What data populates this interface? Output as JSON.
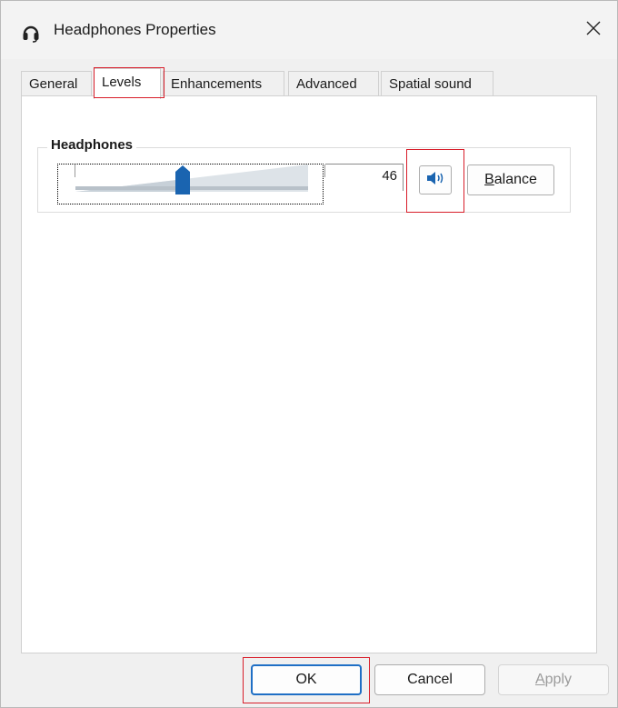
{
  "window": {
    "title": "Headphones Properties",
    "title_icon": "headphones-icon",
    "close_icon": "close-icon"
  },
  "tabs": [
    {
      "label": "General"
    },
    {
      "label": "Levels",
      "active": true
    },
    {
      "label": "Enhancements"
    },
    {
      "label": "Advanced"
    },
    {
      "label": "Spatial sound"
    }
  ],
  "levels": {
    "group_label": "Headphones",
    "volume_value": "46",
    "volume_level": 46,
    "mute_icon": "speaker-icon",
    "balance_prefix": "B",
    "balance_rest": "alance"
  },
  "footer": {
    "ok_label": "OK",
    "cancel_label": "Cancel",
    "apply_prefix": "A",
    "apply_rest": "pply"
  },
  "colors": {
    "highlight": "#d81e2a",
    "accent": "#1f6fc5",
    "thumb": "#1a64b0"
  }
}
